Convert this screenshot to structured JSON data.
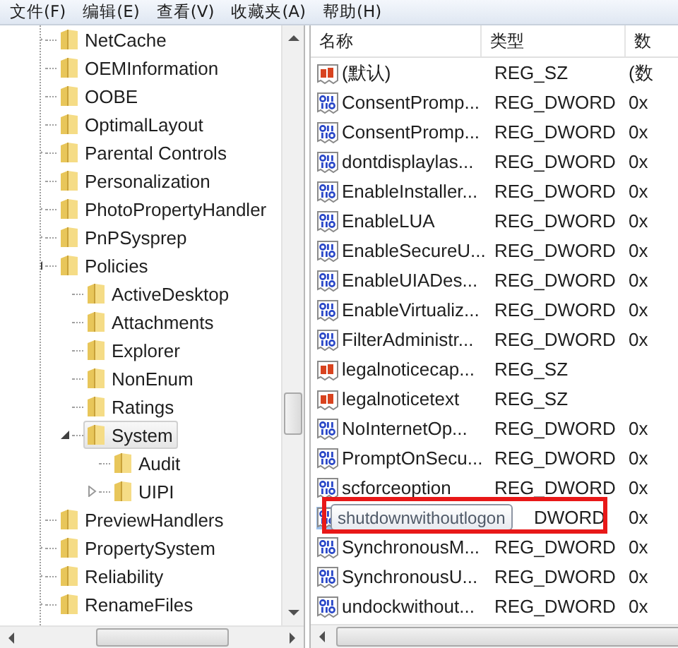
{
  "menu": [
    "文件(F)",
    "编辑(E)",
    "查看(V)",
    "收藏夹(A)",
    "帮助(H)"
  ],
  "tree": [
    {
      "label": "NetCache",
      "expanded": false,
      "selected": false
    },
    {
      "label": "OEMInformation",
      "selected": false
    },
    {
      "label": "OOBE",
      "selected": false
    },
    {
      "label": "OptimalLayout",
      "selected": false
    },
    {
      "label": "Parental Controls",
      "expanded": false,
      "selected": false
    },
    {
      "label": "Personalization",
      "selected": false
    },
    {
      "label": "PhotoPropertyHandler",
      "expanded": false,
      "selected": false
    },
    {
      "label": "PnPSysprep",
      "expanded": false,
      "selected": false
    },
    {
      "label": "Policies",
      "expanded": true,
      "selected": false,
      "children": [
        {
          "label": "ActiveDesktop",
          "selected": false
        },
        {
          "label": "Attachments",
          "selected": false
        },
        {
          "label": "Explorer",
          "selected": false
        },
        {
          "label": "NonEnum",
          "selected": false
        },
        {
          "label": "Ratings",
          "selected": false
        },
        {
          "label": "System",
          "expanded": true,
          "selected": true,
          "children": [
            {
              "label": "Audit",
              "selected": false
            },
            {
              "label": "UIPI",
              "expanded": false,
              "selected": false
            }
          ]
        }
      ]
    },
    {
      "label": "PreviewHandlers",
      "selected": false
    },
    {
      "label": "PropertySystem",
      "expanded": false,
      "selected": false
    },
    {
      "label": "Reliability",
      "expanded": false,
      "selected": false
    },
    {
      "label": "RenameFiles",
      "expanded": false,
      "selected": false
    }
  ],
  "values": {
    "columns": [
      "名称",
      "类型",
      "数"
    ],
    "rows": [
      {
        "kind": "sz",
        "name": "(默认)",
        "type": "REG_SZ",
        "data": "(数",
        "selected": false
      },
      {
        "kind": "dword",
        "name": "ConsentPromp...",
        "type": "REG_DWORD",
        "data": "0x",
        "selected": false
      },
      {
        "kind": "dword",
        "name": "ConsentPromp...",
        "type": "REG_DWORD",
        "data": "0x",
        "selected": false
      },
      {
        "kind": "dword",
        "name": "dontdisplaylas...",
        "type": "REG_DWORD",
        "data": "0x",
        "selected": false
      },
      {
        "kind": "dword",
        "name": "EnableInstaller...",
        "type": "REG_DWORD",
        "data": "0x",
        "selected": false
      },
      {
        "kind": "dword",
        "name": "EnableLUA",
        "type": "REG_DWORD",
        "data": "0x",
        "selected": false
      },
      {
        "kind": "dword",
        "name": "EnableSecureU...",
        "type": "REG_DWORD",
        "data": "0x",
        "selected": false
      },
      {
        "kind": "dword",
        "name": "EnableUIADes...",
        "type": "REG_DWORD",
        "data": "0x",
        "selected": false
      },
      {
        "kind": "dword",
        "name": "EnableVirtualiz...",
        "type": "REG_DWORD",
        "data": "0x",
        "selected": false
      },
      {
        "kind": "dword",
        "name": "FilterAdministr...",
        "type": "REG_DWORD",
        "data": "0x",
        "selected": false
      },
      {
        "kind": "sz",
        "name": "legalnoticecap...",
        "type": "REG_SZ",
        "selected": false
      },
      {
        "kind": "sz",
        "name": "legalnoticetext",
        "type": "REG_SZ",
        "selected": false
      },
      {
        "kind": "dword",
        "name": "NoInternetOp...",
        "type": "REG_DWORD",
        "data": "0x",
        "selected": false
      },
      {
        "kind": "dword",
        "name": "PromptOnSecu...",
        "type": "REG_DWORD",
        "data": "0x",
        "selected": false
      },
      {
        "kind": "dword",
        "name": "scforceoption",
        "type": "REG_DWORD",
        "data": "0x",
        "selected": false
      },
      {
        "kind": "dword",
        "type": "DWORD",
        "data": "0x",
        "selected": true,
        "tooltip": "shutdownwithoutlogon"
      },
      {
        "kind": "dword",
        "name": "SynchronousM...",
        "type": "REG_DWORD",
        "data": "0x",
        "selected": false
      },
      {
        "kind": "dword",
        "name": "SynchronousU...",
        "type": "REG_DWORD",
        "data": "0x",
        "selected": false
      },
      {
        "kind": "dword",
        "name": "undockwithout...",
        "type": "REG_DWORD",
        "data": "0x",
        "selected": false
      }
    ]
  }
}
